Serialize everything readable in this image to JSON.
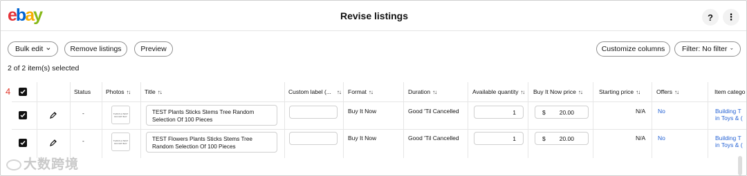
{
  "logo": {
    "letters": [
      "e",
      "b",
      "a",
      "y"
    ]
  },
  "header": {
    "title": "Revise listings",
    "help_label": "?",
    "more_label": "⋮"
  },
  "toolbar": {
    "bulk_edit": "Bulk edit",
    "remove_listings": "Remove listings",
    "preview": "Preview",
    "customize_columns": "Customize columns",
    "filter": "Filter: No filter"
  },
  "selection_text": "2 of 2 item(s) selected",
  "row_marker": "4",
  "columns": {
    "status": "Status",
    "photos": "Photos",
    "title": "Title",
    "custom_label": "Custom label (...",
    "format": "Format",
    "duration": "Duration",
    "available_quantity": "Available quantity",
    "buy_it_now_price": "Buy It Now price",
    "starting_price": "Starting price",
    "offers": "Offers",
    "item_category": "Item catego"
  },
  "sort_glyph": "↑↓",
  "rows": [
    {
      "status": "-",
      "photo_caption": "THIS IS A TEST DO NOT BUY",
      "title": "TEST Plants Sticks Stems Tree Random Selection Of 100 Pieces",
      "custom_label": "",
      "format": "Buy It Now",
      "duration": "Good 'Til Cancelled",
      "quantity": "1",
      "currency": "$",
      "price": "20.00",
      "starting_price": "N/A",
      "offers": "No",
      "category_line1": "Building T",
      "category_line2": "in Toys & ("
    },
    {
      "status": "-",
      "photo_caption": "THIS IS A TEST DO NOT BUY",
      "title": "TEST Flowers Plants Sticks Stems Tree Random Selection Of 100 Pieces",
      "custom_label": "",
      "format": "Buy It Now",
      "duration": "Good 'Til Cancelled",
      "quantity": "1",
      "currency": "$",
      "price": "20.00",
      "starting_price": "N/A",
      "offers": "No",
      "category_line1": "Building T",
      "category_line2": "in Toys & ("
    }
  ],
  "watermark": "大数跨境"
}
